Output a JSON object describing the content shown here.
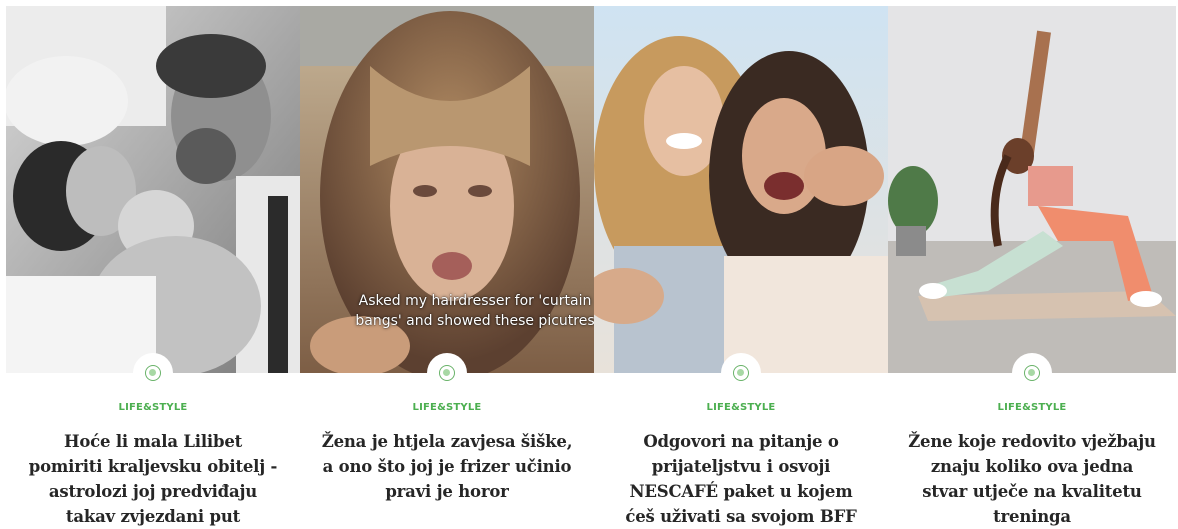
{
  "cards": [
    {
      "category": "LIFE&STYLE",
      "title": "Hoće li mala Lilibet pomiriti kraljevsku obitelj - astrolozi joj predviđaju takav zvjezdani put",
      "badge_icon": "life-style-icon"
    },
    {
      "category": "LIFE&STYLE",
      "title": "Žena je htjela zavjesa šiške, a ono što joj je frizer učinio pravi je horor",
      "image_caption": "Asked my hairdresser for 'curtain bangs' and showed these picutres",
      "badge_icon": "life-style-icon"
    },
    {
      "category": "LIFE&STYLE",
      "title": "Odgovori na pitanje o prijateljstvu i osvoji NESCAFÉ paket u kojem ćeš uživati sa svojom BFF",
      "badge_icon": "life-style-icon"
    },
    {
      "category": "LIFE&STYLE",
      "title": "Žene koje redovito vježbaju znaju koliko ova jedna stvar utječe na kvalitetu treninga",
      "badge_icon": "life-style-icon"
    }
  ],
  "colors": {
    "accent": "#4caf50",
    "title": "#262626",
    "badge_ring": "#6ab36a"
  }
}
